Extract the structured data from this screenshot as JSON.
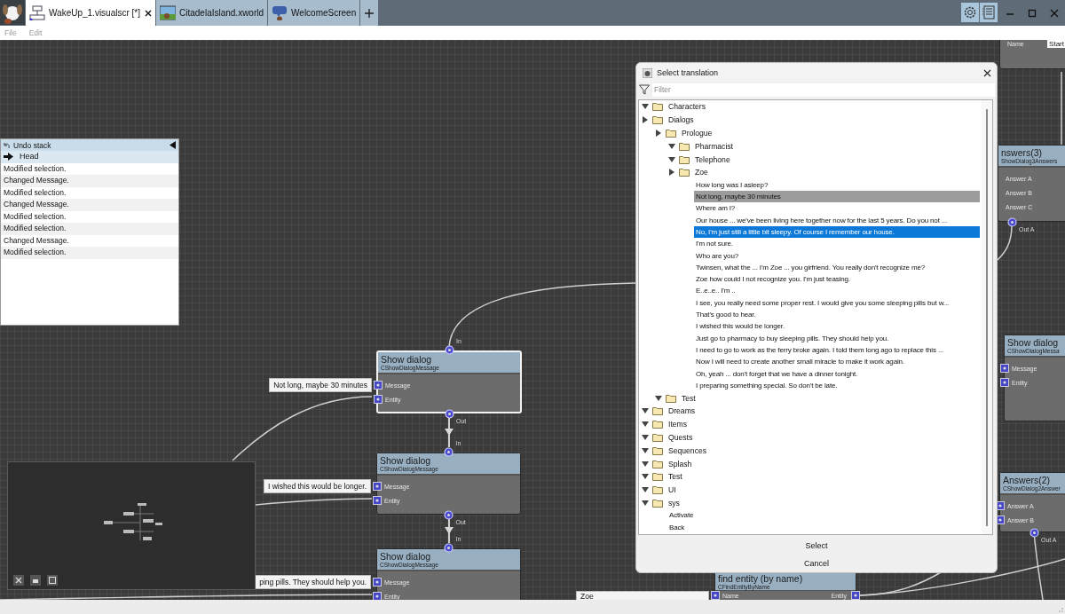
{
  "tabs": [
    {
      "label": "WakeUp_1.visualscr [*]",
      "selected": true
    },
    {
      "label": "CitadelaIsland.xworld",
      "selected": false
    },
    {
      "label": "WelcomeScreen",
      "selected": false
    }
  ],
  "menu": [
    "File",
    "Edit"
  ],
  "undo_stack": {
    "title": "Undo stack",
    "items": [
      {
        "label": "Head",
        "kind": "head",
        "selected": true
      },
      {
        "label": "Modified selection.",
        "kind": "action",
        "selected": false
      },
      {
        "label": "Changed Message.",
        "kind": "action",
        "selected": false
      },
      {
        "label": "Modified selection.",
        "kind": "action",
        "selected": false
      },
      {
        "label": "Changed Message.",
        "kind": "action",
        "selected": false
      },
      {
        "label": "Modified selection.",
        "kind": "action",
        "selected": false
      },
      {
        "label": "Modified selection.",
        "kind": "action",
        "selected": false
      },
      {
        "label": "Changed Message.",
        "kind": "action",
        "selected": false
      },
      {
        "label": "Modified selection.",
        "kind": "action",
        "selected": false
      }
    ]
  },
  "nodes": [
    {
      "title": "Show dialog",
      "subtitle": "CShowDialogMessage",
      "selected": true,
      "in_label": "In",
      "out_label": "Out",
      "ports": [
        {
          "kind": "input",
          "label": "Message",
          "value": "Not long, maybe 30 minutes"
        },
        {
          "kind": "input",
          "label": "Entity"
        }
      ]
    },
    {
      "title": "Show dialog",
      "subtitle": "CShowDialogMessage",
      "selected": false,
      "in_label": "In",
      "out_label": "Out",
      "ports": [
        {
          "kind": "input",
          "label": "Message",
          "value": "I wished this would be longer."
        },
        {
          "kind": "input",
          "label": "Entity"
        }
      ]
    },
    {
      "title": "Show dialog",
      "subtitle": "CShowDialogMessage",
      "selected": false,
      "in_label": "In",
      "ports": [
        {
          "kind": "input",
          "label": "Message",
          "value": "ping pills. They should help you."
        },
        {
          "kind": "input",
          "label": "Entity"
        }
      ]
    },
    {
      "selected": false,
      "ports": [
        {
          "kind": "inline",
          "label": "Name",
          "value": "Start"
        }
      ]
    },
    {
      "title": "nswers(3)",
      "subtitle": "ShowDialog3Answers",
      "selected": false,
      "out_label": "Out A",
      "ports": [
        {
          "kind": "label",
          "label": "Answer A"
        },
        {
          "kind": "label",
          "label": "Answer B"
        },
        {
          "kind": "label",
          "label": "Answer C"
        }
      ]
    },
    {
      "title": "Show dialog",
      "subtitle": "CShowDialogMessa",
      "selected": false,
      "ports": [
        {
          "kind": "input",
          "label": "Message"
        },
        {
          "kind": "input",
          "label": "Entity"
        }
      ]
    },
    {
      "title": "Answers(2)",
      "subtitle": "CShowDialog2Answer",
      "selected": false,
      "out_label": "Out A",
      "ports": [
        {
          "kind": "input",
          "label": "Answer A"
        },
        {
          "kind": "input",
          "label": "Answer B"
        }
      ]
    },
    {
      "title": "find entity (by name)",
      "subtitle": "CFindEntityByName",
      "selected": false,
      "ports": [
        {
          "kind": "input",
          "label": "Name",
          "value": "Zoe"
        }
      ],
      "outputs": [
        "Entity"
      ]
    }
  ],
  "dialog": {
    "title": "Select translation",
    "filter": {
      "placeholder": "Filter"
    },
    "tree": [
      {
        "kind": "folder",
        "label": "Characters",
        "expanded": true
      },
      {
        "kind": "folder",
        "label": "Dialogs",
        "expanded": false,
        "children": [
          {
            "kind": "folder",
            "label": "Prologue",
            "expanded": false,
            "children": [
              {
                "kind": "folder",
                "label": "Pharmacist",
                "expanded": true
              },
              {
                "kind": "folder",
                "label": "Telephone",
                "expanded": true
              },
              {
                "kind": "folder",
                "label": "Zoe",
                "expanded": false,
                "children": [
                  {
                    "kind": "text",
                    "label": "How long was I asleep?",
                    "selected": false,
                    "current": false
                  },
                  {
                    "kind": "text",
                    "label": "Not long, maybe 30 minutes",
                    "selected": false,
                    "current": true
                  },
                  {
                    "kind": "text",
                    "label": "Where am I?",
                    "selected": false,
                    "current": false
                  },
                  {
                    "kind": "text",
                    "label": "Our house ... we've been living here together now for the last 5 years. Do you not ...",
                    "selected": false,
                    "current": false
                  },
                  {
                    "kind": "text",
                    "label": "No, I'm just still a little bit sleepy. Of course I remember our house.",
                    "selected": true,
                    "current": false
                  },
                  {
                    "kind": "text",
                    "label": "I'm not sure.",
                    "selected": false,
                    "current": false
                  },
                  {
                    "kind": "text",
                    "label": "Who are you?",
                    "selected": false,
                    "current": false
                  },
                  {
                    "kind": "text",
                    "label": "Twinsen, what the ... I'm Zoe ... you girfriend. You really don't recognize me?",
                    "selected": false,
                    "current": false
                  },
                  {
                    "kind": "text",
                    "label": "Zoe how could I not recognize you. I'm just teasing.",
                    "selected": false,
                    "current": false
                  },
                  {
                    "kind": "text",
                    "label": "E..e..e.. I'm ..",
                    "selected": false,
                    "current": false
                  },
                  {
                    "kind": "text",
                    "label": "I see, you really need some proper rest. I would give you some sleeping pills but w...",
                    "selected": false,
                    "current": false
                  },
                  {
                    "kind": "text",
                    "label": "That's good to hear.",
                    "selected": false,
                    "current": false
                  },
                  {
                    "kind": "text",
                    "label": "I wished this would be longer.",
                    "selected": false,
                    "current": false
                  },
                  {
                    "kind": "text",
                    "label": "Just go to pharmacy to buy sleeping pills. They should help you.",
                    "selected": false,
                    "current": false
                  },
                  {
                    "kind": "text",
                    "label": "I need to go to work as the ferry broke again. I told them long ago to replace this ...",
                    "selected": false,
                    "current": false
                  },
                  {
                    "kind": "text",
                    "label": "Now I will need to create another small miracle to make it work again.",
                    "selected": false,
                    "current": false
                  },
                  {
                    "kind": "text",
                    "label": "Oh, yeah ... don't forget that we have a dinner tonight.",
                    "selected": false,
                    "current": false
                  },
                  {
                    "kind": "text",
                    "label": "I preparing something special. So don't be late.",
                    "selected": false,
                    "current": false
                  }
                ]
              }
            ]
          },
          {
            "kind": "folder",
            "label": "Test",
            "expanded": true
          }
        ]
      },
      {
        "kind": "folder",
        "label": "Dreams",
        "expanded": true
      },
      {
        "kind": "folder",
        "label": "Items",
        "expanded": true
      },
      {
        "kind": "folder",
        "label": "Quests",
        "expanded": true
      },
      {
        "kind": "folder",
        "label": "Sequences",
        "expanded": true
      },
      {
        "kind": "folder",
        "label": "Splash",
        "expanded": true
      },
      {
        "kind": "folder",
        "label": "Test",
        "expanded": true
      },
      {
        "kind": "folder",
        "label": "UI",
        "expanded": true
      },
      {
        "kind": "folder",
        "label": "sys",
        "expanded": true,
        "children": [
          {
            "kind": "text",
            "label": "Activate",
            "selected": false,
            "current": false
          },
          {
            "kind": "text",
            "label": "Back",
            "selected": false,
            "current": false
          }
        ]
      }
    ],
    "buttons": [
      "Select",
      "Cancel"
    ]
  }
}
